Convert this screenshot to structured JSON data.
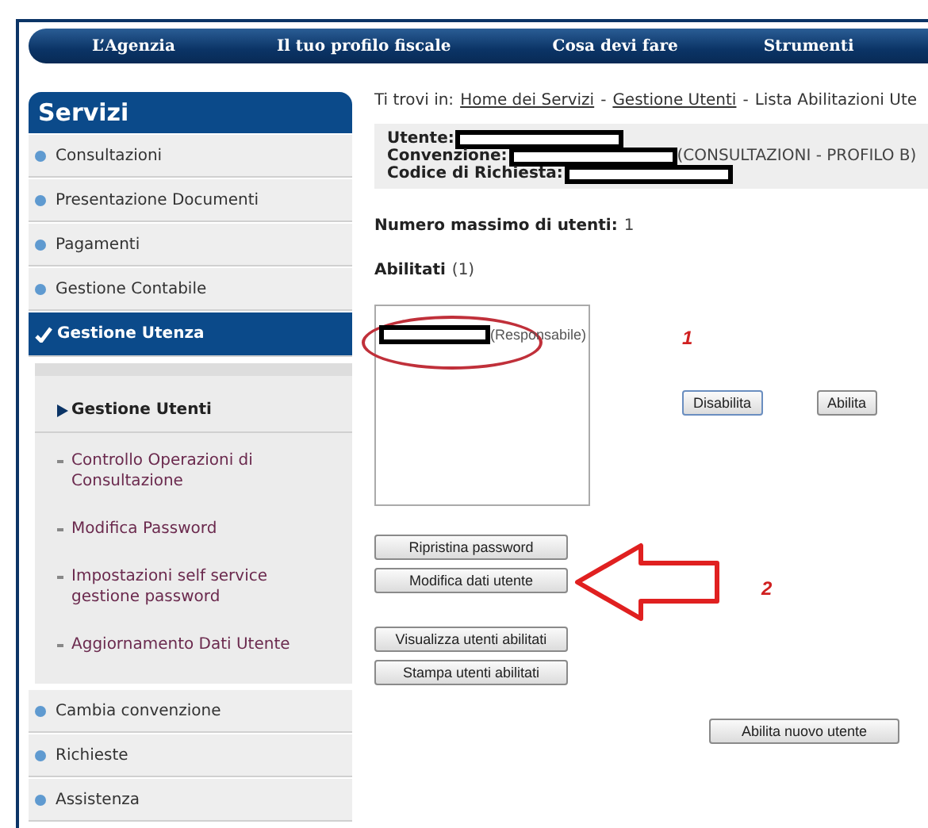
{
  "nav": [
    {
      "label": "L’Agenzia"
    },
    {
      "label": "Il tuo profilo fiscale"
    },
    {
      "label": "Cosa devi fare"
    },
    {
      "label": "Strumenti"
    }
  ],
  "sidebar": {
    "title": "Servizi",
    "items": [
      {
        "label": "Consultazioni",
        "selected": false
      },
      {
        "label": "Presentazione Documenti",
        "selected": false
      },
      {
        "label": "Pagamenti",
        "selected": false
      },
      {
        "label": "Gestione Contabile",
        "selected": false
      },
      {
        "label": "Gestione Utenza",
        "selected": true,
        "expanded": true,
        "children": [
          {
            "label": "Gestione Utenti",
            "selected": true
          },
          {
            "label": "Controllo Operazioni di Consultazione",
            "selected": false
          },
          {
            "label": "Modifica Password",
            "selected": false
          },
          {
            "label": "Impostazioni self service gestione password",
            "selected": false
          },
          {
            "label": "Aggiornamento Dati Utente",
            "selected": false
          }
        ]
      },
      {
        "label": "Cambia convenzione",
        "selected": false
      },
      {
        "label": "Richieste",
        "selected": false
      },
      {
        "label": "Assistenza",
        "selected": false
      }
    ]
  },
  "breadcrumb": [
    {
      "kind": "text",
      "text": "Ti trovi in:"
    },
    {
      "kind": "link",
      "text": "Home dei Servizi"
    },
    {
      "kind": "text",
      "text": "-"
    },
    {
      "kind": "link",
      "text": "Gestione Utenti"
    },
    {
      "kind": "text",
      "text": "-"
    },
    {
      "kind": "text",
      "text": "Lista Abilitazioni Ute"
    }
  ],
  "info": [
    {
      "label": "Utente:",
      "redacted": true
    },
    {
      "label": "Convenzione:",
      "redacted": true,
      "suffix": "(CONSULTAZIONI - PROFILO B)"
    },
    {
      "label": "Codice di Richiesta:",
      "redacted": true
    }
  ],
  "max_users": {
    "label": "Numero massimo di utenti:",
    "value": "1"
  },
  "enabled": {
    "label": "Abilitati",
    "count": "(1)"
  },
  "user_list": [
    {
      "redacted": true,
      "role": "(Responsabile)",
      "callout": {
        "kind": "ellipse",
        "label": "1"
      }
    }
  ],
  "list_buttons": [
    {
      "label": "Disabilita",
      "focused": true
    },
    {
      "label": "Abilita",
      "focused": false
    }
  ],
  "button_groups": [
    [
      {
        "label": "Ripristina password"
      },
      {
        "label": "Modifica dati utente",
        "callout": {
          "kind": "arrow",
          "label": "2"
        }
      }
    ],
    [
      {
        "label": "Visualizza utenti abilitati"
      },
      {
        "label": "Stampa utenti abilitati"
      }
    ]
  ],
  "new_user_button": {
    "label": "Abilita nuovo utente"
  }
}
